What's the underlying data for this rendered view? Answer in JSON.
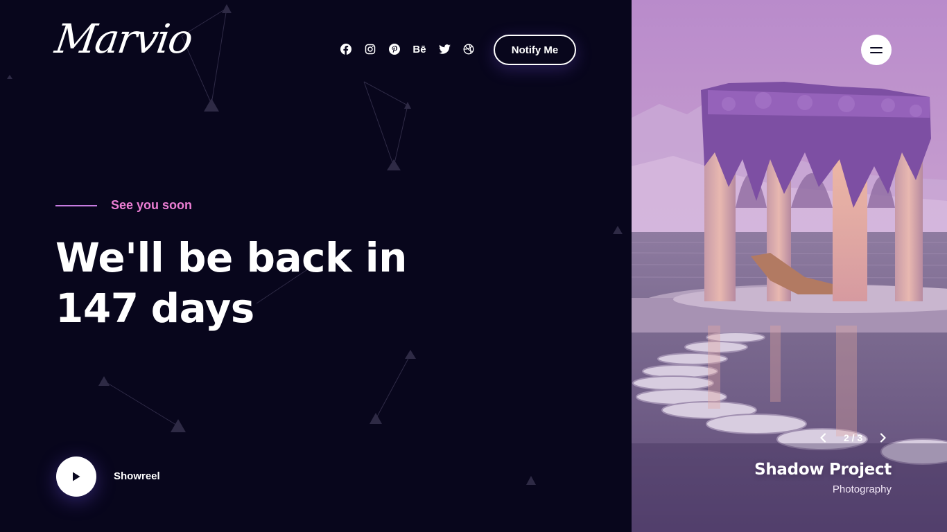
{
  "brand": {
    "logo_text": "Marvio"
  },
  "social": [
    {
      "name": "facebook",
      "glyph": "f"
    },
    {
      "name": "instagram",
      "glyph": ""
    },
    {
      "name": "pinterest",
      "glyph": "p"
    },
    {
      "name": "behance",
      "glyph": "Bē"
    },
    {
      "name": "twitter",
      "glyph": ""
    },
    {
      "name": "dribbble",
      "glyph": ""
    }
  ],
  "header": {
    "notify_label": "Notify Me"
  },
  "hero": {
    "tagline": "See you soon",
    "headline_line1": "We'll be back in",
    "days_count": "147",
    "days_label": "days"
  },
  "showreel": {
    "label": "Showreel"
  },
  "slider": {
    "counter": "2 / 3",
    "project_title": "Shadow Project",
    "project_category": "Photography"
  },
  "colors": {
    "background": "#08061c",
    "accent_pink": "#ec7ed4",
    "accent_line": "#c67be0",
    "image_tone": "#b58fca"
  }
}
